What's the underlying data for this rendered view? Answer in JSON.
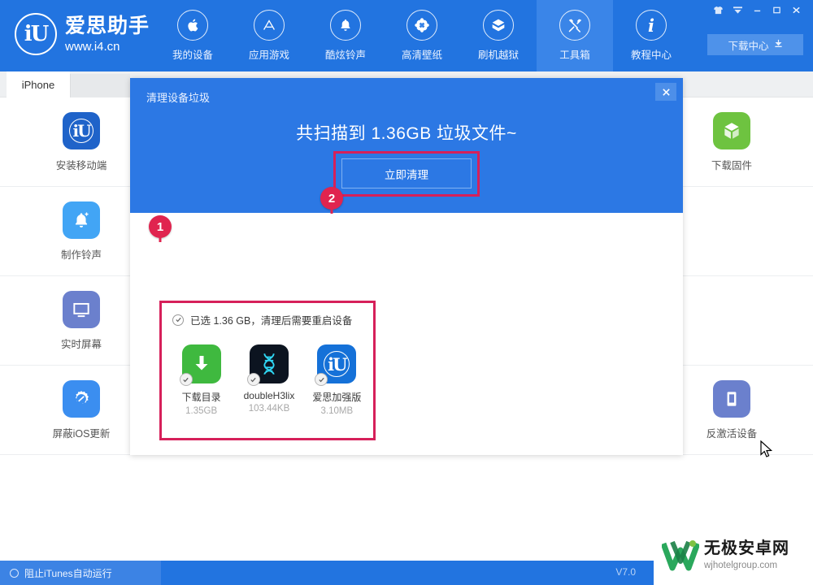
{
  "header": {
    "brand": {
      "logo_text": "iU",
      "name": "爱思助手",
      "url": "www.i4.cn"
    },
    "nav": [
      {
        "label": "我的设备",
        "icon": "apple-icon",
        "active": false
      },
      {
        "label": "应用游戏",
        "icon": "appstore-icon",
        "active": false
      },
      {
        "label": "酷炫铃声",
        "icon": "bell-icon",
        "active": false
      },
      {
        "label": "高清壁纸",
        "icon": "flower-icon",
        "active": false
      },
      {
        "label": "刷机越狱",
        "icon": "box-icon",
        "active": false
      },
      {
        "label": "工具箱",
        "icon": "tools-icon",
        "active": true
      },
      {
        "label": "教程中心",
        "icon": "info-icon",
        "active": false
      }
    ],
    "window_controls": [
      {
        "name": "skin-icon",
        "glyph": "skin"
      },
      {
        "name": "chevron-down-icon",
        "glyph": "chevron"
      },
      {
        "name": "minimize-icon",
        "glyph": "minimize"
      },
      {
        "name": "maximize-icon",
        "glyph": "maximize"
      },
      {
        "name": "close-icon",
        "glyph": "close"
      }
    ],
    "download_center": {
      "label": "下载中心",
      "icon": "download-icon"
    }
  },
  "tabs": [
    {
      "label": "iPhone",
      "active": true
    }
  ],
  "tiles": [
    {
      "label": "安装移动端",
      "icon": "i4-app-icon",
      "color": "#1f63c9"
    },
    {
      "label": "",
      "icon": "",
      "color": ""
    },
    {
      "label": "",
      "icon": "",
      "color": ""
    },
    {
      "label": "",
      "icon": "",
      "color": ""
    },
    {
      "label": "下载固件",
      "icon": "cube-icon",
      "color": "#6ec340"
    },
    {
      "label": "制作铃声",
      "icon": "ringtone-icon",
      "color": "#42a5f5"
    },
    {
      "label": "",
      "icon": "",
      "color": ""
    },
    {
      "label": "",
      "icon": "",
      "color": ""
    },
    {
      "label": "",
      "icon": "",
      "color": ""
    },
    {
      "label": "",
      "icon": "",
      "color": ""
    },
    {
      "label": "实时屏幕",
      "icon": "monitor-icon",
      "color": "#6b80cd"
    },
    {
      "label": "",
      "icon": "",
      "color": ""
    },
    {
      "label": "",
      "icon": "",
      "color": ""
    },
    {
      "label": "",
      "icon": "",
      "color": ""
    },
    {
      "label": "",
      "icon": "",
      "color": ""
    },
    {
      "label": "屏蔽iOS更新",
      "icon": "block-update-icon",
      "color": "#3b8ef0"
    },
    {
      "label": "",
      "icon": "",
      "color": ""
    },
    {
      "label": "",
      "icon": "",
      "color": ""
    },
    {
      "label": "",
      "icon": "",
      "color": ""
    },
    {
      "label": "反激活设备",
      "icon": "deactivate-icon",
      "color": "#6b80cd"
    }
  ],
  "dialog": {
    "title": "清理设备垃圾",
    "close_label": "✕",
    "scan_result": "共扫描到 1.36GB 垃圾文件~",
    "clean_button": "立即清理",
    "selection_note": "已选 1.36 GB，清理后需要重启设备",
    "files": [
      {
        "name": "下载目录",
        "size": "1.35GB",
        "icon": "download-folder-icon",
        "color": "#3fb93f",
        "checked": true
      },
      {
        "name": "doubleH3lix",
        "size": "103.44KB",
        "icon": "dna-icon",
        "color": "#0c1420",
        "checked": true
      },
      {
        "name": "爱思加强版",
        "size": "3.10MB",
        "icon": "i4-app-icon",
        "color": "#1571d8",
        "checked": true
      }
    ],
    "steps": [
      {
        "number": "1"
      },
      {
        "number": "2"
      }
    ]
  },
  "footer": {
    "itunes_toggle_label": "阻止iTunes自动运行",
    "version": "V7.0"
  },
  "watermark": {
    "title": "无极安卓网",
    "subtitle": "wjhotelgroup.com"
  },
  "colors": {
    "brand_blue": "#2274e0",
    "nav_active": "#3a85e8",
    "dialog_blue": "#2c78e4",
    "highlight_red": "#d6205a",
    "pin_red": "#e0244f"
  }
}
